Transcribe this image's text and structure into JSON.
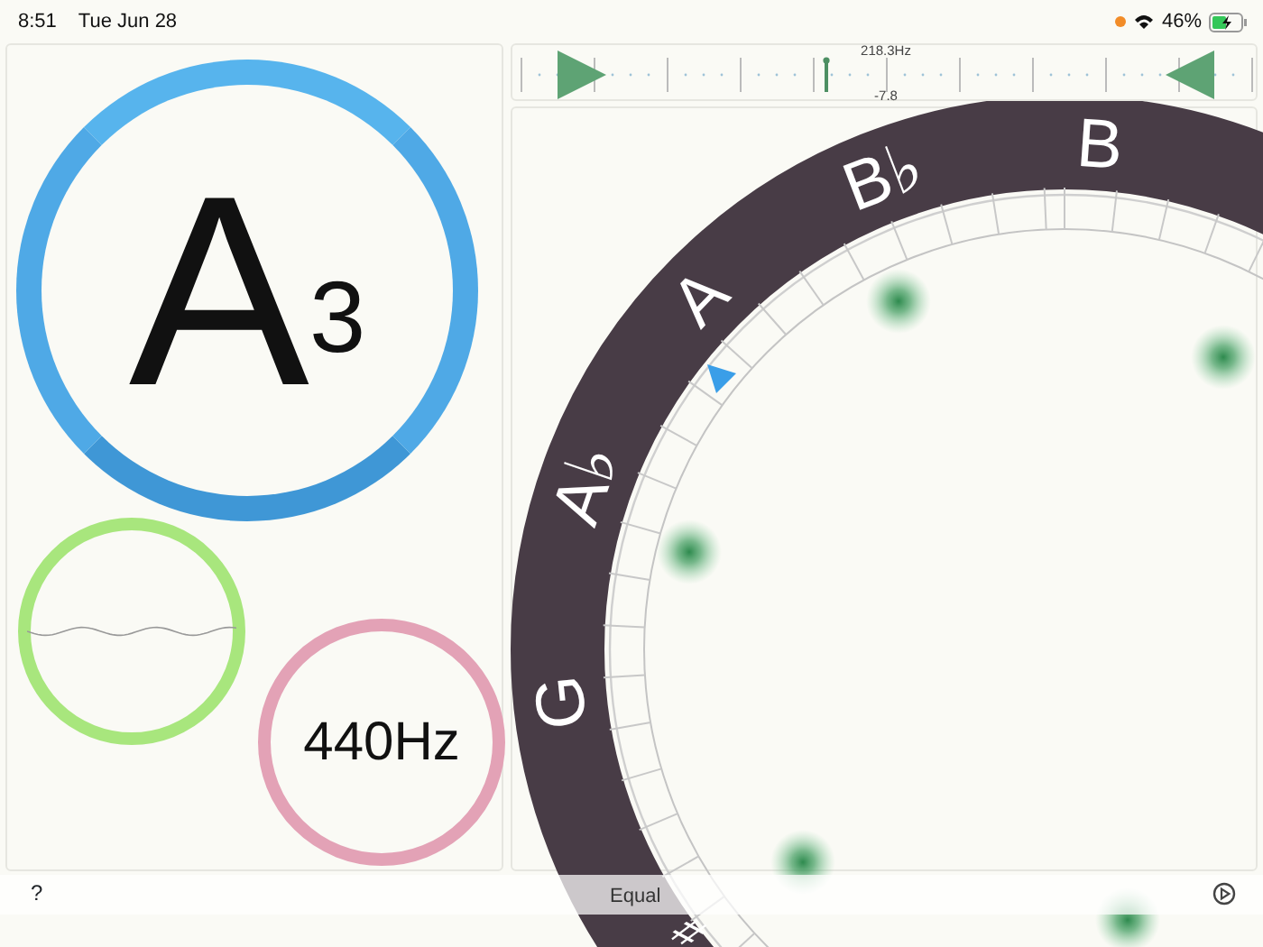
{
  "status_bar": {
    "time": "8:51",
    "date": "Tue Jun 28",
    "battery_text": "46%"
  },
  "meter": {
    "frequency": "218.3Hz",
    "cents": "-7.8"
  },
  "note_display": {
    "note": "A",
    "octave": "3"
  },
  "reference": {
    "frequency": "440Hz"
  },
  "wheel": {
    "labels": [
      "B",
      "B♭",
      "A",
      "A♭",
      "G",
      "♯"
    ]
  },
  "bottom_bar": {
    "help": "?",
    "temperament": "Equal"
  }
}
